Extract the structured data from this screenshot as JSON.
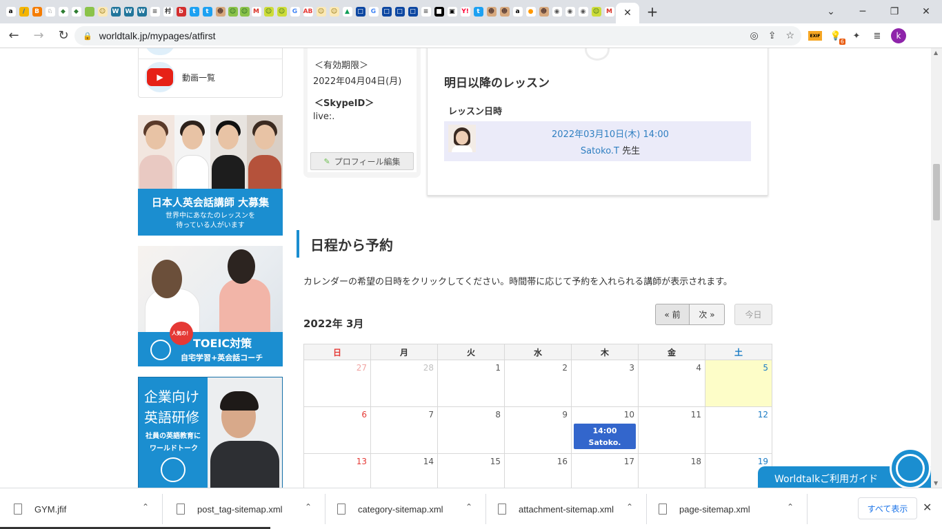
{
  "browser": {
    "favicons": [
      {
        "name": "amazon-favicon",
        "glyph": "a",
        "bg": "#ffffff",
        "fg": "#000000"
      },
      {
        "name": "pen-favicon",
        "glyph": "/",
        "bg": "#f4b400",
        "fg": "#1565c0"
      },
      {
        "name": "blogger-favicon",
        "glyph": "B",
        "bg": "#f57c00",
        "fg": "#ffffff"
      },
      {
        "name": "rabbit-favicon",
        "glyph": "♘",
        "bg": "#ffffff",
        "fg": "#333333"
      },
      {
        "name": "green-leaf-favicon",
        "glyph": "◆",
        "bg": "#ffffff",
        "fg": "#2e7d32"
      },
      {
        "name": "green-leaf-favicon",
        "glyph": "◆",
        "bg": "#ffffff",
        "fg": "#2e7d32"
      },
      {
        "name": "green-box-favicon",
        "glyph": "■",
        "bg": "#8bc34a",
        "fg": "#8bc34a"
      },
      {
        "name": "person-favicon",
        "glyph": "☺",
        "bg": "#fbe9b7",
        "fg": "#8d6e00"
      },
      {
        "name": "wordpress-favicon",
        "glyph": "W",
        "bg": "#21759b",
        "fg": "#ffffff"
      },
      {
        "name": "wordpress-favicon",
        "glyph": "W",
        "bg": "#21759b",
        "fg": "#ffffff"
      },
      {
        "name": "wordpress-favicon",
        "glyph": "W",
        "bg": "#21759b",
        "fg": "#ffffff"
      },
      {
        "name": "filter-favicon",
        "glyph": "≡",
        "bg": "#ffffff",
        "fg": "#555555"
      },
      {
        "name": "village-favicon",
        "glyph": "村",
        "bg": "#ffffff",
        "fg": "#333333"
      },
      {
        "name": "ad-favicon",
        "glyph": "b",
        "bg": "#d32f2f",
        "fg": "#ffffff"
      },
      {
        "name": "twitter-favicon",
        "glyph": "t",
        "bg": "#1da1f2",
        "fg": "#ffffff"
      },
      {
        "name": "twitter-favicon",
        "glyph": "t",
        "bg": "#1da1f2",
        "fg": "#ffffff"
      },
      {
        "name": "monkey-favicon",
        "glyph": "☻",
        "bg": "#d7a97e",
        "fg": "#5d4037"
      },
      {
        "name": "frog-favicon",
        "glyph": "☺",
        "bg": "#8bc34a",
        "fg": "#1b5e20"
      },
      {
        "name": "frog-favicon",
        "glyph": "☺",
        "bg": "#8bc34a",
        "fg": "#1b5e20"
      },
      {
        "name": "gmail-favicon",
        "glyph": "M",
        "bg": "#ffffff",
        "fg": "#d93025"
      },
      {
        "name": "smile-favicon",
        "glyph": "☺",
        "bg": "#cddc39",
        "fg": "#33691e"
      },
      {
        "name": "smile-favicon",
        "glyph": "☺",
        "bg": "#cddc39",
        "fg": "#33691e"
      },
      {
        "name": "google-favicon",
        "glyph": "G",
        "bg": "#ffffff",
        "fg": "#4285f4"
      },
      {
        "name": "ab-favicon",
        "glyph": "AB",
        "bg": "#ffffff",
        "fg": "#e53935"
      },
      {
        "name": "person-favicon",
        "glyph": "☺",
        "bg": "#fbe9b7",
        "fg": "#8d6e00"
      },
      {
        "name": "person-favicon",
        "glyph": "☺",
        "bg": "#fbe9b7",
        "fg": "#8d6e00"
      },
      {
        "name": "drive-favicon",
        "glyph": "▲",
        "bg": "#ffffff",
        "fg": "#0f9d58"
      },
      {
        "name": "box-favicon",
        "glyph": "□",
        "bg": "#0d47a1",
        "fg": "#ffffff"
      },
      {
        "name": "google-favicon",
        "glyph": "G",
        "bg": "#ffffff",
        "fg": "#4285f4"
      },
      {
        "name": "box-favicon",
        "glyph": "□",
        "bg": "#0d47a1",
        "fg": "#ffffff"
      },
      {
        "name": "box-favicon",
        "glyph": "□",
        "bg": "#0d47a1",
        "fg": "#ffffff"
      },
      {
        "name": "box-favicon",
        "glyph": "□",
        "bg": "#0d47a1",
        "fg": "#ffffff"
      },
      {
        "name": "filter-favicon",
        "glyph": "≡",
        "bg": "#ffffff",
        "fg": "#555555"
      },
      {
        "name": "black-square-favicon",
        "glyph": "■",
        "bg": "#000000",
        "fg": "#ffffff"
      },
      {
        "name": "stamp-favicon",
        "glyph": "▣",
        "bg": "#ffffff",
        "fg": "#000000"
      },
      {
        "name": "yahoo-favicon",
        "glyph": "Y!",
        "bg": "#ffffff",
        "fg": "#ff0033"
      },
      {
        "name": "twitter-favicon",
        "glyph": "t",
        "bg": "#1da1f2",
        "fg": "#ffffff"
      },
      {
        "name": "monkey-favicon",
        "glyph": "☻",
        "bg": "#d7a97e",
        "fg": "#5d4037"
      },
      {
        "name": "monkey-favicon",
        "glyph": "☻",
        "bg": "#d7a97e",
        "fg": "#5d4037"
      },
      {
        "name": "amazon-favicon",
        "glyph": "a",
        "bg": "#ffffff",
        "fg": "#000000"
      },
      {
        "name": "orange-favicon",
        "glyph": "●",
        "bg": "#ffffff",
        "fg": "#ff9800"
      },
      {
        "name": "monkey-favicon",
        "glyph": "☻",
        "bg": "#d7a97e",
        "fg": "#5d4037"
      },
      {
        "name": "globe-favicon",
        "glyph": "◉",
        "bg": "#ffffff",
        "fg": "#555555"
      },
      {
        "name": "globe-favicon",
        "glyph": "◉",
        "bg": "#ffffff",
        "fg": "#555555"
      },
      {
        "name": "globe-favicon",
        "glyph": "◉",
        "bg": "#ffffff",
        "fg": "#555555"
      },
      {
        "name": "smile-favicon",
        "glyph": "☺",
        "bg": "#cddc39",
        "fg": "#33691e"
      },
      {
        "name": "gmail-favicon",
        "glyph": "M",
        "bg": "#ffffff",
        "fg": "#d93025"
      }
    ],
    "active_tab_close": "✕",
    "new_tab_label": "+",
    "window_controls": {
      "dropdown": "⌄",
      "minimize": "─",
      "maximize": "❐",
      "close": "✕"
    },
    "nav": {
      "back": "←",
      "forward": "→",
      "reload": "↻"
    },
    "url": "worldtalk.jp/mypages/atfirst",
    "lock_glyph": "🔒",
    "omni_icons": {
      "eye_off": "◎",
      "share": "⇪",
      "star": "☆"
    },
    "extensions": {
      "exif_label": "EXIF",
      "bulb_glyph": "💡",
      "bulb_badge": "6",
      "puzzle_glyph": "✦",
      "media_glyph": "≣",
      "profile_initial": "k"
    }
  },
  "sidebar": {
    "video_label": "動画一覧",
    "youtube_glyph": "▶",
    "banner_recruit": {
      "title": "日本人英会話講師 大募集",
      "sub1": "世界中にあなたのレッスンを",
      "sub2": "待っている人がいます"
    },
    "banner_toeic": {
      "badge": "人気の！",
      "title": "TOEIC対策",
      "sub": "自宅学習+英会話コーチ"
    },
    "banner_corporate": {
      "title1": "企業向け",
      "title2": "英語研修",
      "sub1": "社員の英語教育に",
      "sub2": "ワールドトーク"
    }
  },
  "profile": {
    "expiry_label": "＜有効期限＞",
    "expiry_value": "2022年04月04日(月)",
    "skype_label": "＜SkypeID＞",
    "skype_value": "live:.",
    "edit_icon": "✎",
    "edit_label": "プロフィール編集"
  },
  "lessons": {
    "title": "明日以降のレッスン",
    "column_header": "レッスン日時",
    "items": [
      {
        "datetime": "2022年03月10日(木) 14:00",
        "teacher": "Satoko.T",
        "suffix": " 先生"
      }
    ]
  },
  "schedule": {
    "title": "日程から予約",
    "description": "カレンダーの希望の日時をクリックしてください。時間帯に応じて予約を入れられる講師が表示されます。",
    "month_label": "2022年 3月",
    "prev_label": "« 前",
    "next_label": "次 »",
    "today_label": "今日"
  },
  "calendar": {
    "weekdays": [
      "日",
      "月",
      "火",
      "水",
      "木",
      "金",
      "土"
    ],
    "weeks": [
      [
        {
          "day": "27",
          "other": true
        },
        {
          "day": "28",
          "other": true
        },
        {
          "day": "1"
        },
        {
          "day": "2"
        },
        {
          "day": "3"
        },
        {
          "day": "4"
        },
        {
          "day": "5",
          "today": true
        }
      ],
      [
        {
          "day": "6"
        },
        {
          "day": "7"
        },
        {
          "day": "8"
        },
        {
          "day": "9"
        },
        {
          "day": "10",
          "event": {
            "time": "14:00",
            "name": "Satoko."
          }
        },
        {
          "day": "11"
        },
        {
          "day": "12"
        }
      ],
      [
        {
          "day": "13"
        },
        {
          "day": "14"
        },
        {
          "day": "15"
        },
        {
          "day": "16"
        },
        {
          "day": "17"
        },
        {
          "day": "18"
        },
        {
          "day": "19"
        }
      ]
    ]
  },
  "guide": {
    "label": "Worldtalkご利用ガイド"
  },
  "downloads": {
    "items": [
      "GYM.jfif",
      "post_tag-sitemap.xml",
      "category-sitemap.xml",
      "attachment-sitemap.xml",
      "page-sitemap.xml"
    ],
    "chevron": "⌃",
    "show_all": "すべて表示",
    "close": "✕"
  },
  "scrollbar": {
    "up": "▲",
    "down": "▼"
  }
}
